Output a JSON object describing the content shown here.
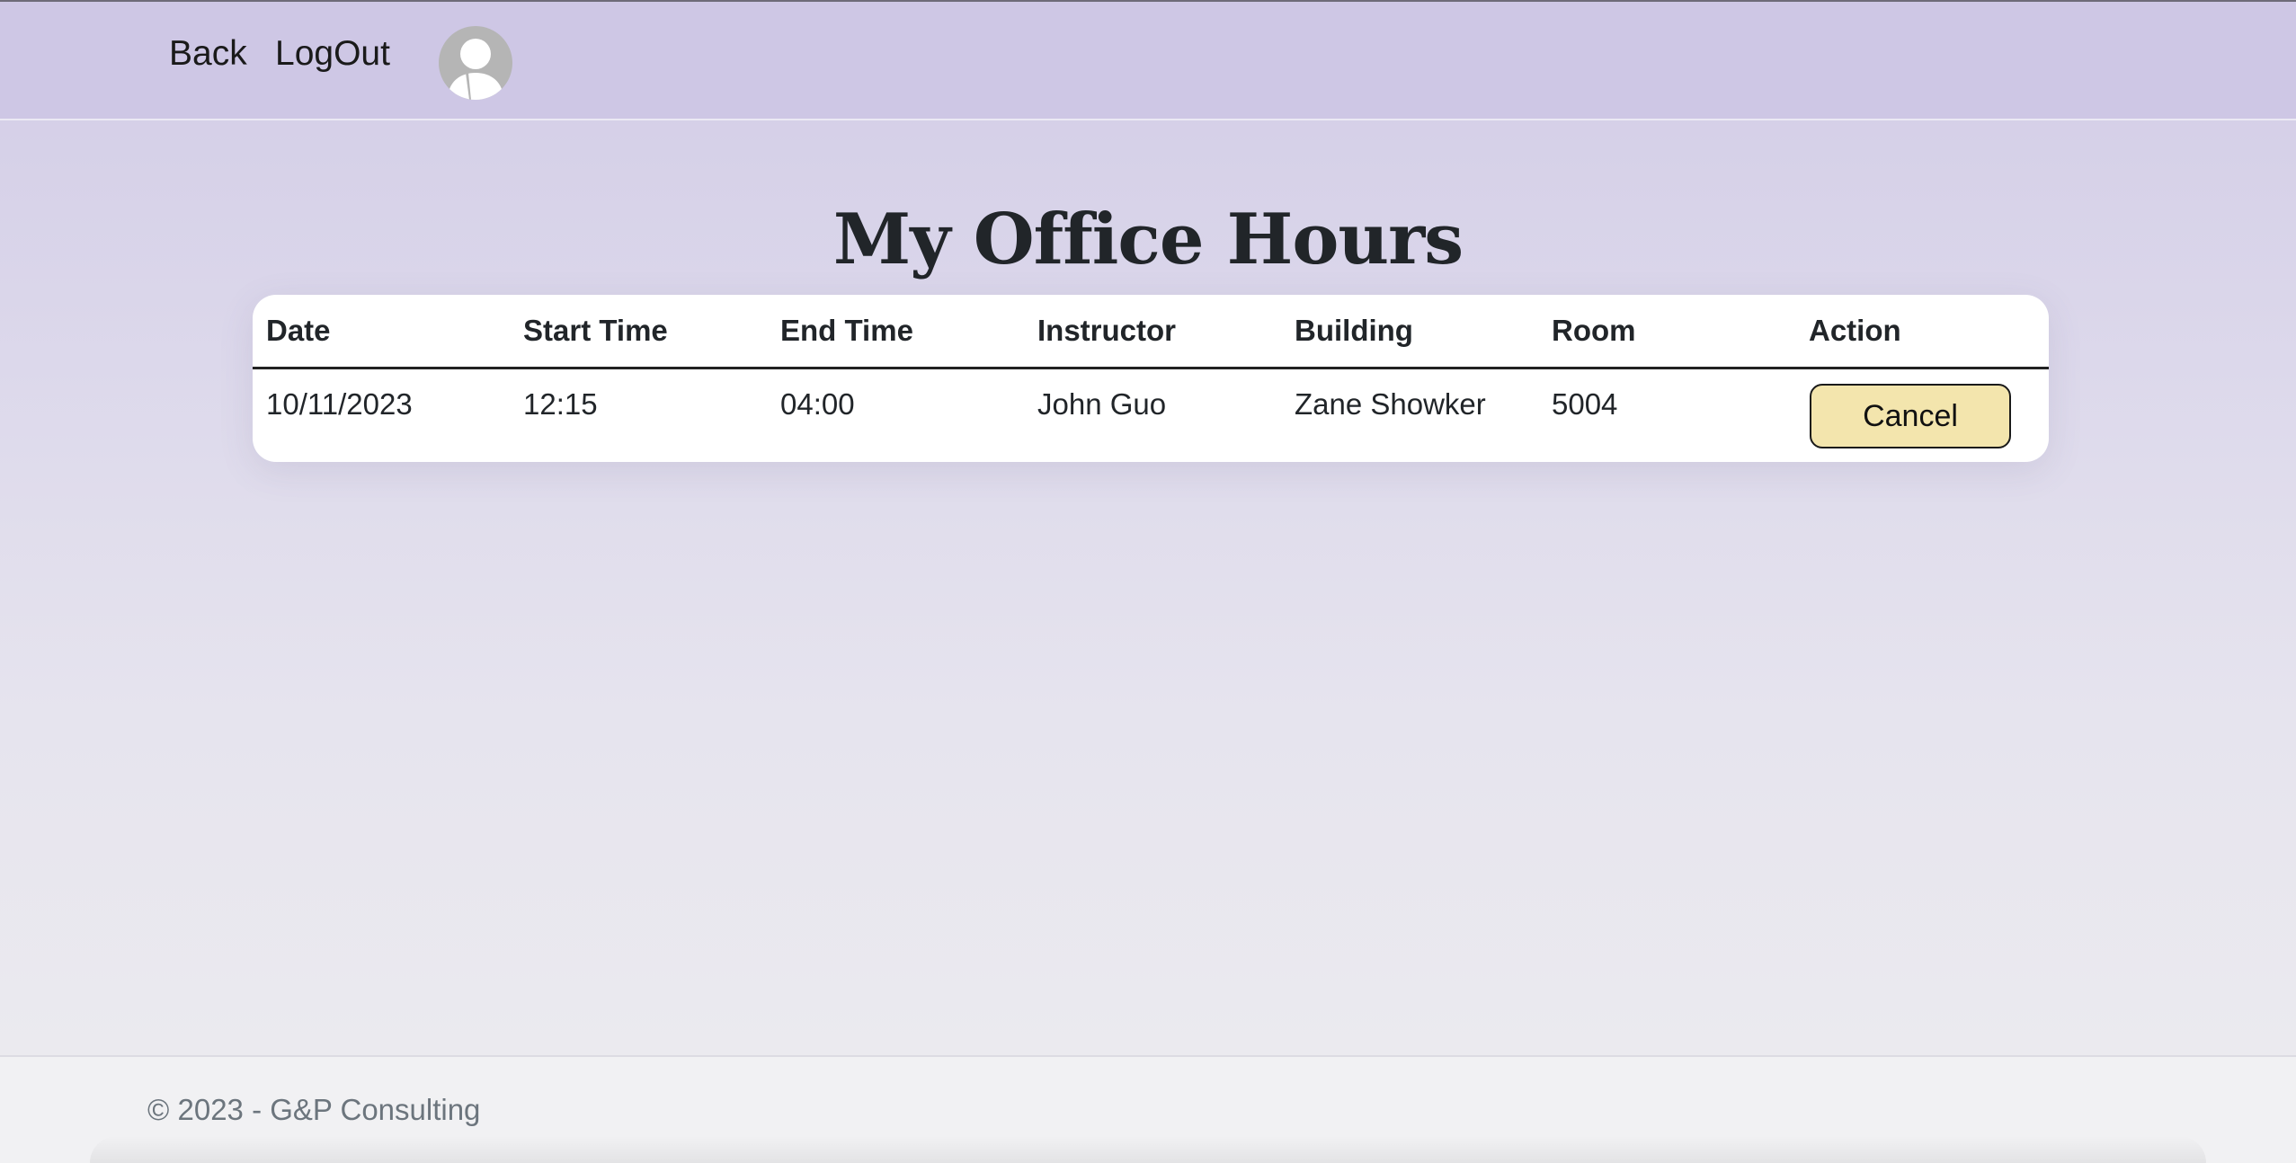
{
  "nav": {
    "back_label": "Back",
    "logout_label": "LogOut",
    "avatar_icon": "user-avatar-icon"
  },
  "page": {
    "title": "My Office Hours"
  },
  "table": {
    "columns": [
      "Date",
      "Start Time",
      "End Time",
      "Instructor",
      "Building",
      "Room",
      "Action"
    ],
    "rows": [
      {
        "date": "10/11/2023",
        "start_time": "12:15",
        "end_time": "04:00",
        "instructor": "John Guo",
        "building": "Zane Showker",
        "room": "5004",
        "action_label": "Cancel"
      }
    ]
  },
  "footer": {
    "text": "© 2023 - G&P Consulting"
  },
  "colors": {
    "header_bg": "#cec7e5",
    "cancel_button_bg": "#f3e5ad",
    "footer_text": "#6c757d"
  }
}
